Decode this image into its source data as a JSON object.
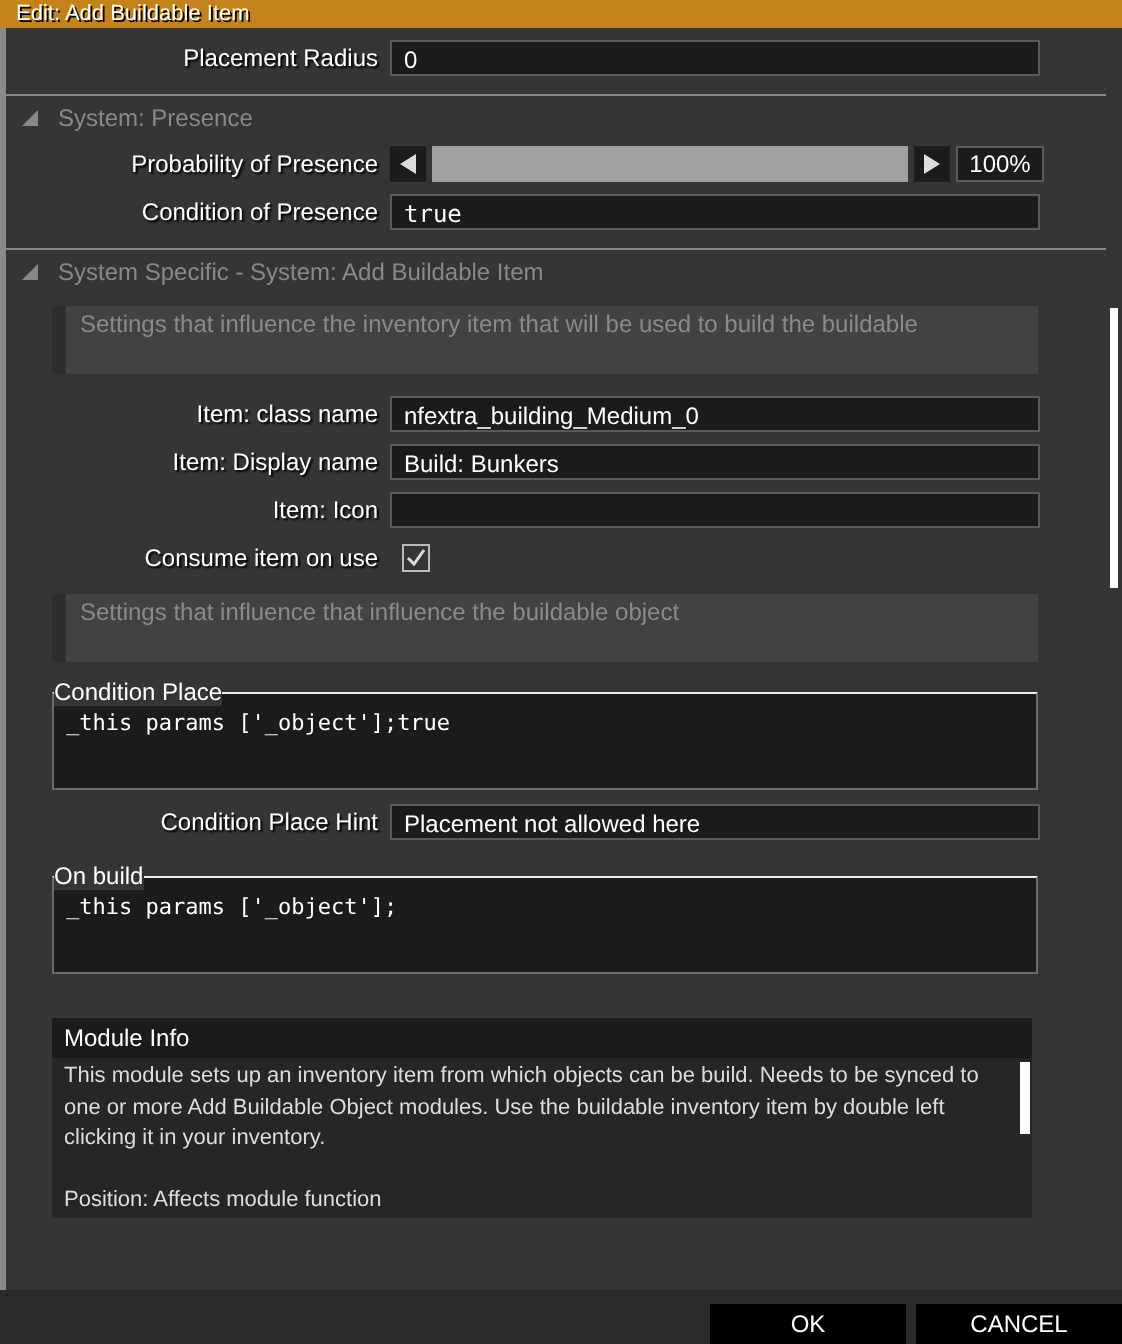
{
  "window": {
    "title": "Edit: Add Buildable Item"
  },
  "top_fields": [
    {
      "kind": "text",
      "label": "Placement Radius",
      "value": "0",
      "monospace": false
    }
  ],
  "sections": [
    {
      "title": "System: Presence",
      "expanded": true,
      "items": [
        {
          "kind": "slider",
          "label": "Probability of Presence",
          "level": 1,
          "reading": "100%"
        },
        {
          "kind": "text",
          "label": "Condition of Presence",
          "value": "true",
          "monospace": true
        }
      ]
    },
    {
      "title": "System Specific - System: Add Buildable Item",
      "expanded": true,
      "items": [
        {
          "kind": "note",
          "text": "Settings that influence the inventory item that will be used to build the buildable"
        },
        {
          "kind": "text",
          "label": "Item: class name",
          "value": "nfextra_building_Medium_0",
          "monospace": false
        },
        {
          "kind": "text",
          "label": "Item: Display name",
          "value": "Build: Bunkers",
          "monospace": false
        },
        {
          "kind": "text",
          "label": "Item: Icon",
          "value": "",
          "monospace": false
        },
        {
          "kind": "checkbox",
          "label": "Consume item on use",
          "checked": true
        },
        {
          "kind": "note",
          "text": "Settings that influence that influence the buildable object"
        },
        {
          "kind": "code",
          "label": "Condition Place",
          "value": "_this params ['_object'];true"
        },
        {
          "kind": "text",
          "label": "Condition Place Hint",
          "value": "Placement not allowed here",
          "monospace": false
        },
        {
          "kind": "code",
          "label": "On build",
          "value": "_this params ['_object'];"
        }
      ]
    }
  ],
  "module_info": {
    "title": "Module Info",
    "paragraphs": [
      "This module sets up an inventory item from which objects can be build. Needs to be synced to one or more Add Buildable Object modules. Use the buildable inventory item by double left clicking it in your inventory.",
      "Position: Affects module function"
    ]
  },
  "buttons": [
    "OK",
    "CANCEL"
  ]
}
